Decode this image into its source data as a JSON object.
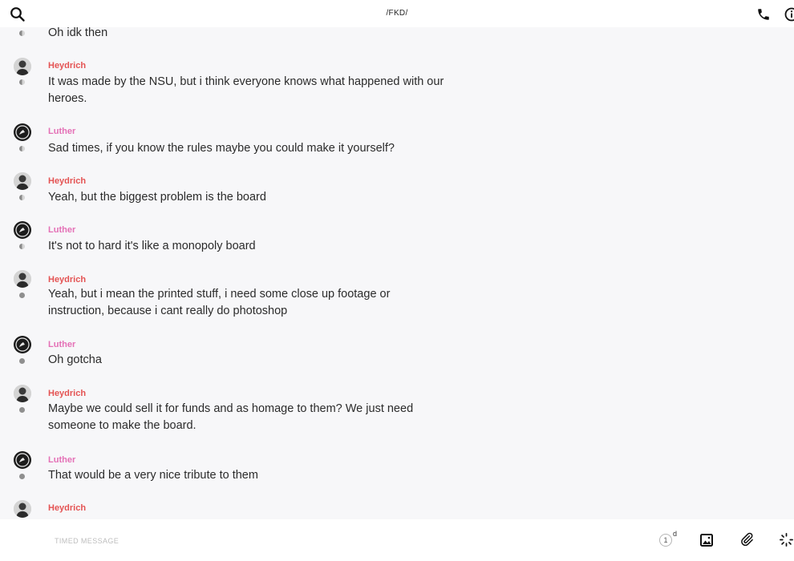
{
  "header": {
    "title": "/FKD/",
    "search_icon": "search-icon",
    "call_icon": "phone-icon",
    "info_icon": "info-icon"
  },
  "messages": [
    {
      "sender": "",
      "text": "Oh idk then",
      "status": "read"
    },
    {
      "sender": "Heydrich",
      "text": "It was made by the NSU, but i think everyone knows what happened with our heroes.",
      "status": "read"
    },
    {
      "sender": "Luther",
      "text": "Sad times, if you know the rules maybe you could make it yourself?",
      "status": "read"
    },
    {
      "sender": "Heydrich",
      "text": "Yeah, but the biggest problem is the board",
      "status": "read"
    },
    {
      "sender": "Luther",
      "text": "It's not to hard it's like a monopoly board",
      "status": "read"
    },
    {
      "sender": "Heydrich",
      "text": "Yeah, but i mean the printed stuff, i need some close up footage or instruction, because i cant really do photoshop",
      "status": "delivered"
    },
    {
      "sender": "Luther",
      "text": "Oh gotcha",
      "status": "delivered"
    },
    {
      "sender": "Heydrich",
      "text": "Maybe we could sell it for funds and as homage to them? We just need someone to make the board.",
      "status": "delivered"
    },
    {
      "sender": "Luther",
      "text": "That would be a very nice tribute to them",
      "status": "delivered"
    },
    {
      "sender": "Heydrich",
      "text": "",
      "status": ""
    }
  ],
  "colors": {
    "heydrich": "#e45353",
    "luther": "#e470b6",
    "background": "#f7f7f9"
  },
  "composer": {
    "placeholder": "TIMED MESSAGE",
    "timer_value": "1",
    "timer_unit": "d",
    "image_icon": "image-icon",
    "attach_icon": "paperclip-icon",
    "more_icon": "loading-icon"
  }
}
